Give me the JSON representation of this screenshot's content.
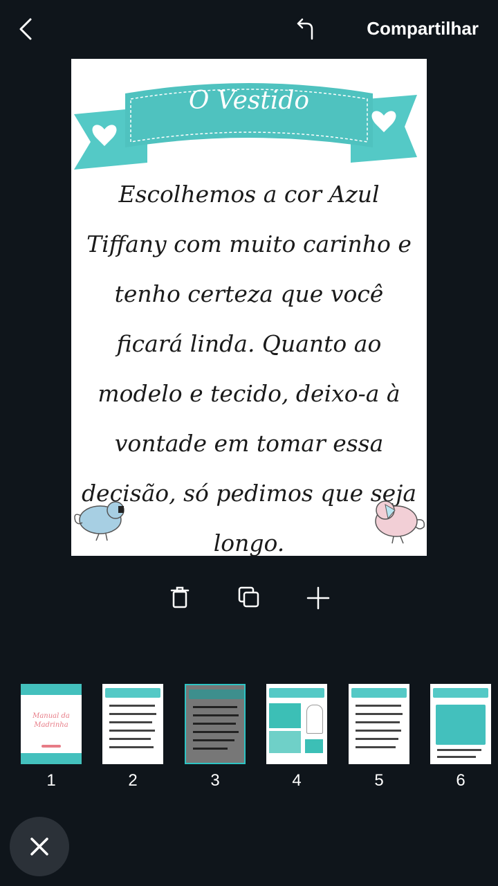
{
  "topbar": {
    "share_label": "Compartilhar",
    "back_icon": "chevron-left-icon",
    "undo_icon": "undo-icon"
  },
  "page": {
    "banner_title": "O Vestido",
    "text": "Escolhemos a cor Azul Tiffany com muito carinho e tenho certeza que você ficará linda. Quanto ao modelo e tecido, deixo-a à vontade em tomar essa decisão, só pedimos que seja longo.",
    "accent_color": "#54c9c6"
  },
  "tools": {
    "delete_icon": "trash-icon",
    "duplicate_icon": "copy-icon",
    "add_icon": "plus-icon"
  },
  "thumbnails": [
    {
      "number": "1",
      "label": "Manual da Madrinha"
    },
    {
      "number": "2"
    },
    {
      "number": "3",
      "selected": true
    },
    {
      "number": "4"
    },
    {
      "number": "5"
    },
    {
      "number": "6"
    }
  ],
  "close_icon": "close-icon"
}
